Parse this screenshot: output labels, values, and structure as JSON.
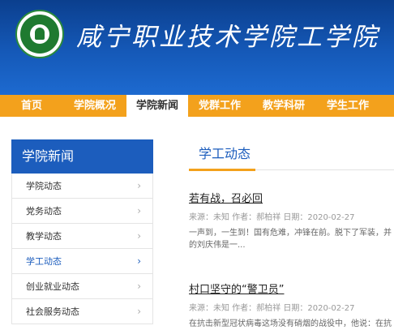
{
  "site": {
    "title": "咸宁职业技术学院工学院"
  },
  "nav": {
    "items": [
      "首页",
      "学院概况",
      "学院新闻",
      "党群工作",
      "教学科研",
      "学生工作"
    ],
    "active_index": 2
  },
  "sidebar": {
    "heading": "学院新闻",
    "items": [
      "学院动态",
      "党务动态",
      "教学动态",
      "学工动态",
      "创业就业动态",
      "社会服务动态"
    ],
    "active_index": 3
  },
  "content": {
    "section_title": "学工动态",
    "articles": [
      {
        "title": "若有战，召必回",
        "meta": "来源：未知  作者：郝柏祥  日期：2020-02-27",
        "summary_line1": "一声到，一生到！国有危难，冲锋在前。脱下了军装，并",
        "summary_line2": "的刘庆伟是一..."
      },
      {
        "title": "村口坚守的“警卫员”",
        "meta": "来源：未知  作者：郝柏祥  日期：2020-02-27",
        "summary_line1": "在抗击新型冠状病毒这场没有硝烟的战役中，他说：在抗"
      }
    ]
  },
  "colors": {
    "brand_blue": "#1c5dbd",
    "nav_orange": "#f3a11c",
    "logo_green": "#1f7a30"
  },
  "icons": {
    "chevron": "chevron-right-icon",
    "logo": "college-emblem-icon"
  }
}
